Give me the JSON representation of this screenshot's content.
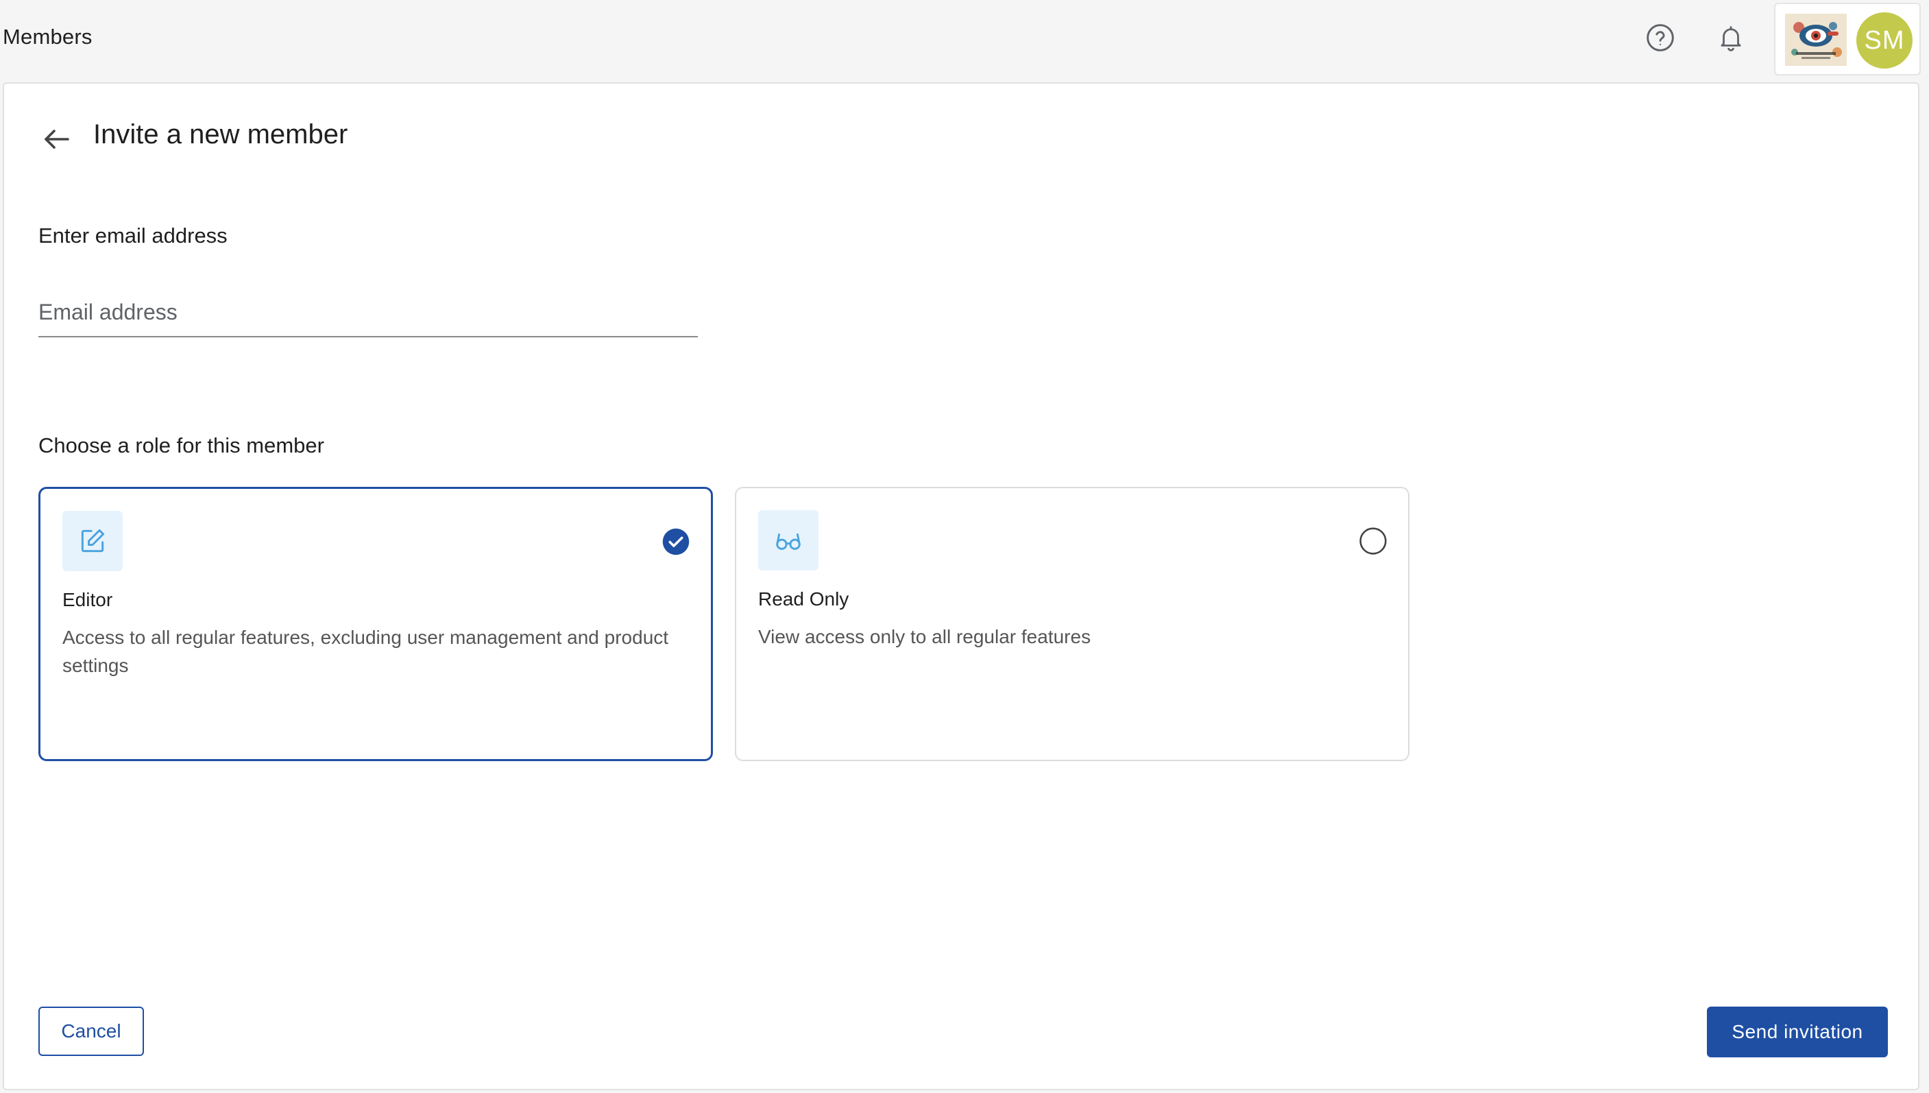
{
  "header": {
    "title": "Members",
    "icons": {
      "help": "help-circle-icon",
      "notifications": "bell-icon"
    },
    "account": {
      "initials": "SM",
      "avatar_color": "#c3c94b"
    }
  },
  "page": {
    "title": "Invite a new member",
    "back_icon": "arrow-left-icon"
  },
  "email": {
    "label": "Enter email address",
    "placeholder": "Email address",
    "value": ""
  },
  "roles": {
    "label": "Choose a role for this member",
    "options": [
      {
        "name": "Editor",
        "description": "Access to all regular features, excluding user management and product settings",
        "icon": "edit-pencil-icon",
        "selected": true
      },
      {
        "name": "Read Only",
        "description": "View access only to all regular features",
        "icon": "glasses-icon",
        "selected": false
      }
    ]
  },
  "actions": {
    "cancel_label": "Cancel",
    "send_label": "Send invitation"
  },
  "colors": {
    "primary": "#1f4fa3",
    "icon_accent": "#4aa3df",
    "icon_bg": "#e6f3fc"
  }
}
